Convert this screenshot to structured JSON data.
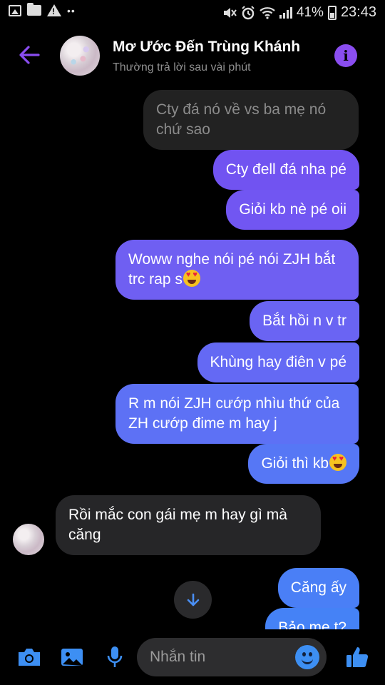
{
  "status_bar": {
    "battery": "41%",
    "time": "23:43"
  },
  "header": {
    "contact_name": "Mơ Ước Đến Trùng Khánh",
    "contact_status": "Thường trả lời sau vài phút"
  },
  "messages": [
    {
      "side": "in",
      "text": "Cty đá nó về vs ba mẹ nó chứ sao"
    },
    {
      "side": "out",
      "text": "Cty đell đá nha pé"
    },
    {
      "side": "out",
      "text": "Giỏi kb nè pé oii"
    },
    {
      "side": "out",
      "text": "Woww nghe nói pé nói ZJH bắt trc rap s",
      "emoji": "heart-eyes"
    },
    {
      "side": "out",
      "text": "Bắt hồi n v tr"
    },
    {
      "side": "out",
      "text": "Khùng hay điên v pé"
    },
    {
      "side": "out",
      "text": "R m nói ZJH cướp nhìu thứ của ZH cướp đime m hay j"
    },
    {
      "side": "out",
      "text": "Giỏi thì kb",
      "emoji": "heart-eyes"
    },
    {
      "side": "in",
      "text": "Rồi mắc con gái mẹ m hay gì mà căng"
    },
    {
      "side": "out",
      "text": "Căng ấy"
    },
    {
      "side": "out",
      "text": "Bảo mẹ t?"
    }
  ],
  "composer": {
    "placeholder": "Nhắn tin"
  },
  "colors": {
    "accent": "#8a4df0",
    "bubble_purple": "#7b5af0",
    "bubble_blue": "#4a7cf6"
  }
}
